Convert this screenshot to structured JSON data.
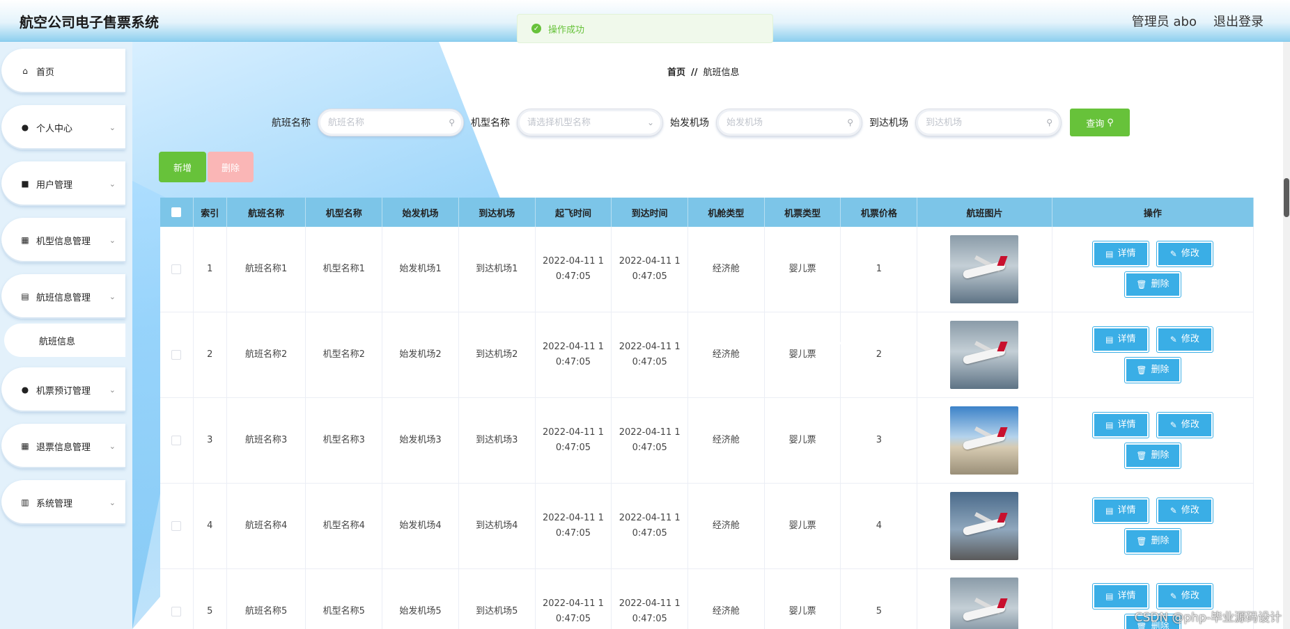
{
  "header": {
    "title": "航空公司电子售票系统",
    "user_label": "管理员 abo",
    "logout_label": "退出登录"
  },
  "toast": {
    "text": "操作成功"
  },
  "sidebar": {
    "items": [
      {
        "label": "首页",
        "icon": "home-icon"
      },
      {
        "label": "个人中心",
        "icon": "user-icon"
      },
      {
        "label": "用户管理",
        "icon": "briefcase-icon"
      },
      {
        "label": "机型信息管理",
        "icon": "grid-icon"
      },
      {
        "label": "航班信息管理",
        "icon": "clipboard-icon"
      },
      {
        "label": "航班信息",
        "icon": ""
      },
      {
        "label": "机票预订管理",
        "icon": "user-icon"
      },
      {
        "label": "退票信息管理",
        "icon": "grid-icon"
      },
      {
        "label": "系统管理",
        "icon": "book-icon"
      }
    ]
  },
  "breadcrumb": {
    "home": "首页",
    "separator": "//",
    "current": "航班信息"
  },
  "search": {
    "flight_label": "航班名称",
    "flight_placeholder": "航班名称",
    "model_label": "机型名称",
    "model_placeholder": "请选择机型名称",
    "dep_label": "始发机场",
    "dep_placeholder": "始发机场",
    "arr_label": "到达机场",
    "arr_placeholder": "到达机场",
    "query_label": "查询"
  },
  "toolbar": {
    "add_label": "新增",
    "delete_label": "删除"
  },
  "table": {
    "headers": [
      "索引",
      "航班名称",
      "机型名称",
      "始发机场",
      "到达机场",
      "起飞时间",
      "到达时间",
      "机舱类型",
      "机票类型",
      "机票价格",
      "航班图片",
      "操作"
    ],
    "rows": [
      {
        "index": "1",
        "name": "航班名称1",
        "model": "机型名称1",
        "dep": "始发机场1",
        "arr": "到达机场1",
        "takeoff": "2022-04-11 10:47:05",
        "arrive": "2022-04-11 10:47:05",
        "cabin": "经济舱",
        "ticket": "婴儿票",
        "price": "1"
      },
      {
        "index": "2",
        "name": "航班名称2",
        "model": "机型名称2",
        "dep": "始发机场2",
        "arr": "到达机场2",
        "takeoff": "2022-04-11 10:47:05",
        "arrive": "2022-04-11 10:47:05",
        "cabin": "经济舱",
        "ticket": "婴儿票",
        "price": "2"
      },
      {
        "index": "3",
        "name": "航班名称3",
        "model": "机型名称3",
        "dep": "始发机场3",
        "arr": "到达机场3",
        "takeoff": "2022-04-11 10:47:05",
        "arrive": "2022-04-11 10:47:05",
        "cabin": "经济舱",
        "ticket": "婴儿票",
        "price": "3"
      },
      {
        "index": "4",
        "name": "航班名称4",
        "model": "机型名称4",
        "dep": "始发机场4",
        "arr": "到达机场4",
        "takeoff": "2022-04-11 10:47:05",
        "arrive": "2022-04-11 10:47:05",
        "cabin": "经济舱",
        "ticket": "婴儿票",
        "price": "4"
      },
      {
        "index": "5",
        "name": "航班名称5",
        "model": "机型名称5",
        "dep": "始发机场5",
        "arr": "到达机场5",
        "takeoff": "2022-04-11 10:47:05",
        "arrive": "2022-04-11 10:47:05",
        "cabin": "经济舱",
        "ticket": "婴儿票",
        "price": "5"
      }
    ],
    "actions": {
      "detail": "详情",
      "edit": "修改",
      "delete": "删除"
    }
  },
  "watermark": "CSDN @php-毕业源码设计"
}
